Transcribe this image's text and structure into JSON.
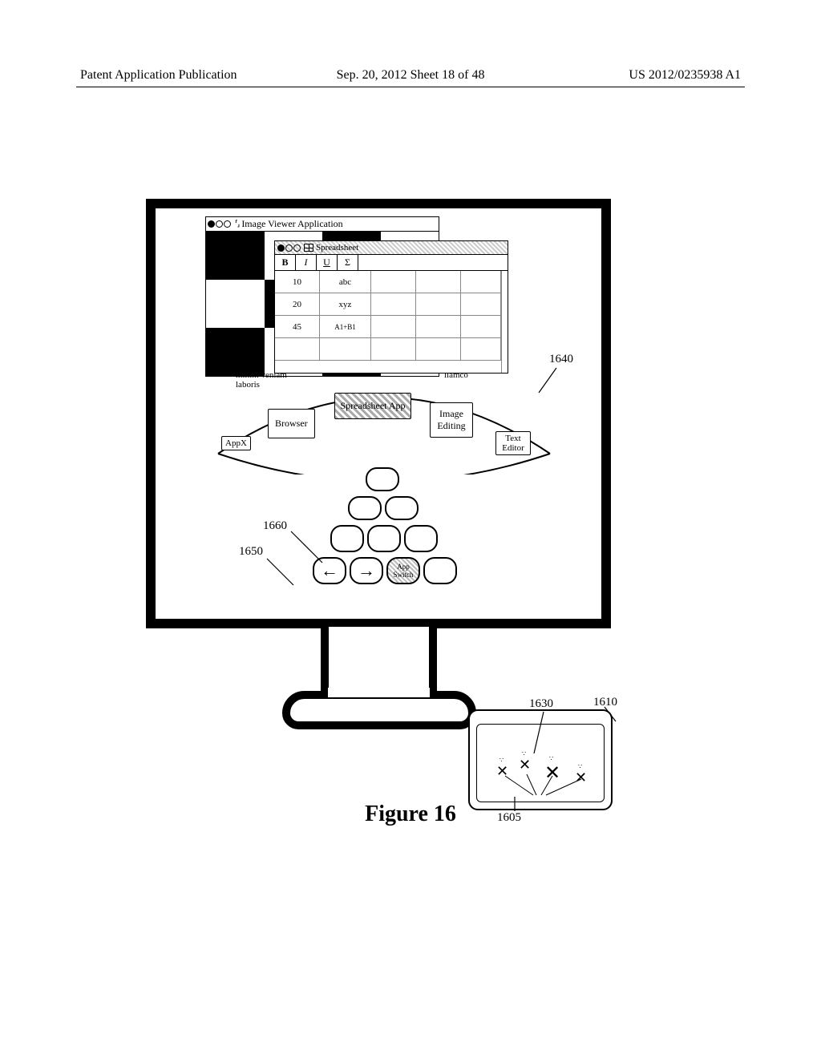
{
  "header": {
    "left": "Patent Application Publication",
    "mid": "Sep. 20, 2012  Sheet 18 of 48",
    "right": "US 2012/0235938 A1"
  },
  "img_viewer": {
    "title": "Image Viewer Application"
  },
  "spreadsheet": {
    "title": "Spreadsheet",
    "toolbar": [
      "B",
      "I",
      "U",
      "Σ"
    ],
    "cells": {
      "a1": "10",
      "b1": "abc",
      "a2": "20",
      "b2": "xyz",
      "a3": "45",
      "b3": "A1+B1"
    }
  },
  "lorem": {
    "line1": "minim veniam",
    "line2": "laboris",
    "line3": "llamco"
  },
  "switcher": {
    "appx": "AppX",
    "browser": "Browser",
    "spreadsheet": "Spreadsheet App",
    "image_edit": "Image Editing",
    "text_editor": "Text Editor"
  },
  "vkbd": {
    "app_switch": "App Switch"
  },
  "refs": {
    "r1640": "1640",
    "r1660": "1660",
    "r1650": "1650",
    "r1630": "1630",
    "r1610": "1610",
    "r1605": "1605"
  },
  "figure": "Figure 16"
}
